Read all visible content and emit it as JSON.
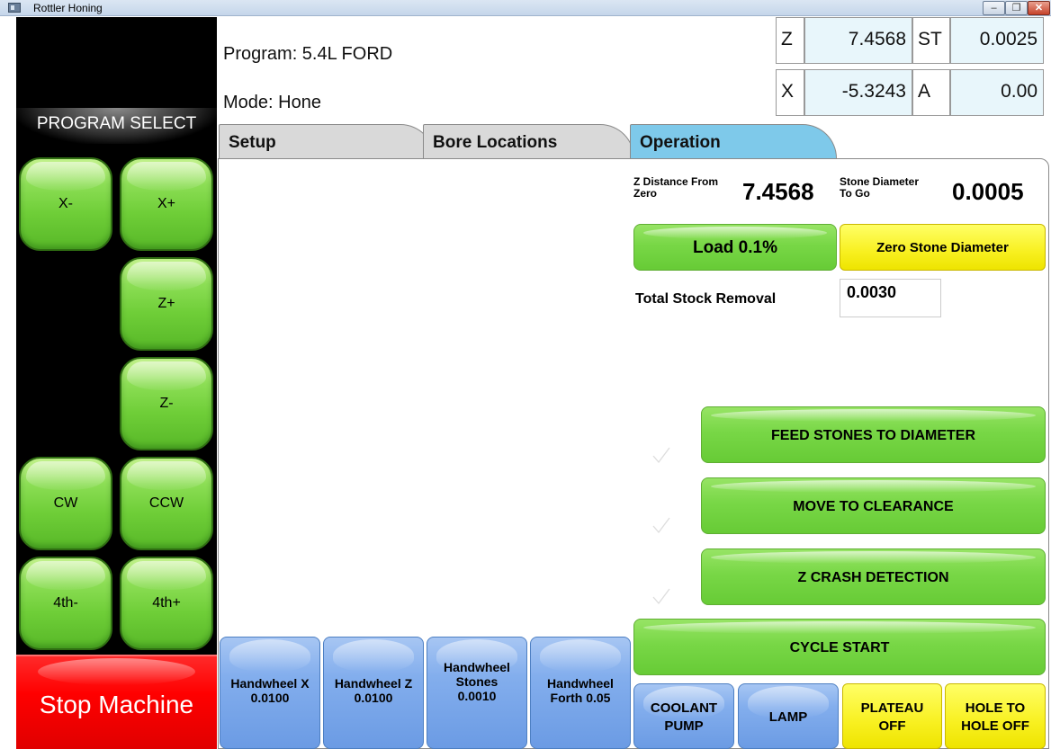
{
  "window": {
    "title": "Rottler Honing"
  },
  "header": {
    "program": "Program: 5.4L FORD",
    "mode": "Mode: Hone"
  },
  "readout": {
    "z_label": "Z",
    "z_value": "7.4568",
    "st_label": "ST",
    "st_value": "0.0025",
    "x_label": "X",
    "x_value": "-5.3243",
    "a_label": "A",
    "a_value": "0.00"
  },
  "left_panel": {
    "program_select": "PROGRAM SELECT",
    "x_minus": "X-",
    "x_plus": "X+",
    "z_plus": "Z+",
    "z_minus": "Z-",
    "cw": "CW",
    "ccw": "CCW",
    "fourth_minus": "4th-",
    "fourth_plus": "4th+",
    "stop": "Stop Machine"
  },
  "tabs": {
    "setup": "Setup",
    "bores": "Bore Locations",
    "operation": "Operation"
  },
  "operation": {
    "z_dist_label1": "Z Distance From",
    "z_dist_label2": "Zero",
    "z_dist_value": "7.4568",
    "stone_label1": "Stone Diameter",
    "stone_label2": "To Go",
    "stone_value": "0.0005",
    "load_button": "Load 0.1%",
    "zero_stone_button": "Zero Stone Diameter",
    "stock_label": "Total Stock Removal",
    "stock_value": "0.0030",
    "feed_button": "FEED STONES TO DIAMETER",
    "move_button": "MOVE TO CLEARANCE",
    "crash_button": "Z CRASH DETECTION",
    "cycle_button": "CYCLE START",
    "coolant_1": "COOLANT",
    "coolant_2": "PUMP",
    "lamp": "LAMP",
    "plateau_1": "PLATEAU",
    "plateau_2": "OFF",
    "hole_1": "HOLE TO",
    "hole_2": "HOLE OFF"
  },
  "handwheels": {
    "hx_1": "Handwheel X",
    "hx_2": "0.0100",
    "hz_1": "Handwheel Z",
    "hz_2": "0.0100",
    "hs_1": "Handwheel",
    "hs_2": "Stones",
    "hs_3": "0.0010",
    "hf_1": "Handwheel",
    "hf_2": "Forth 0.05"
  }
}
